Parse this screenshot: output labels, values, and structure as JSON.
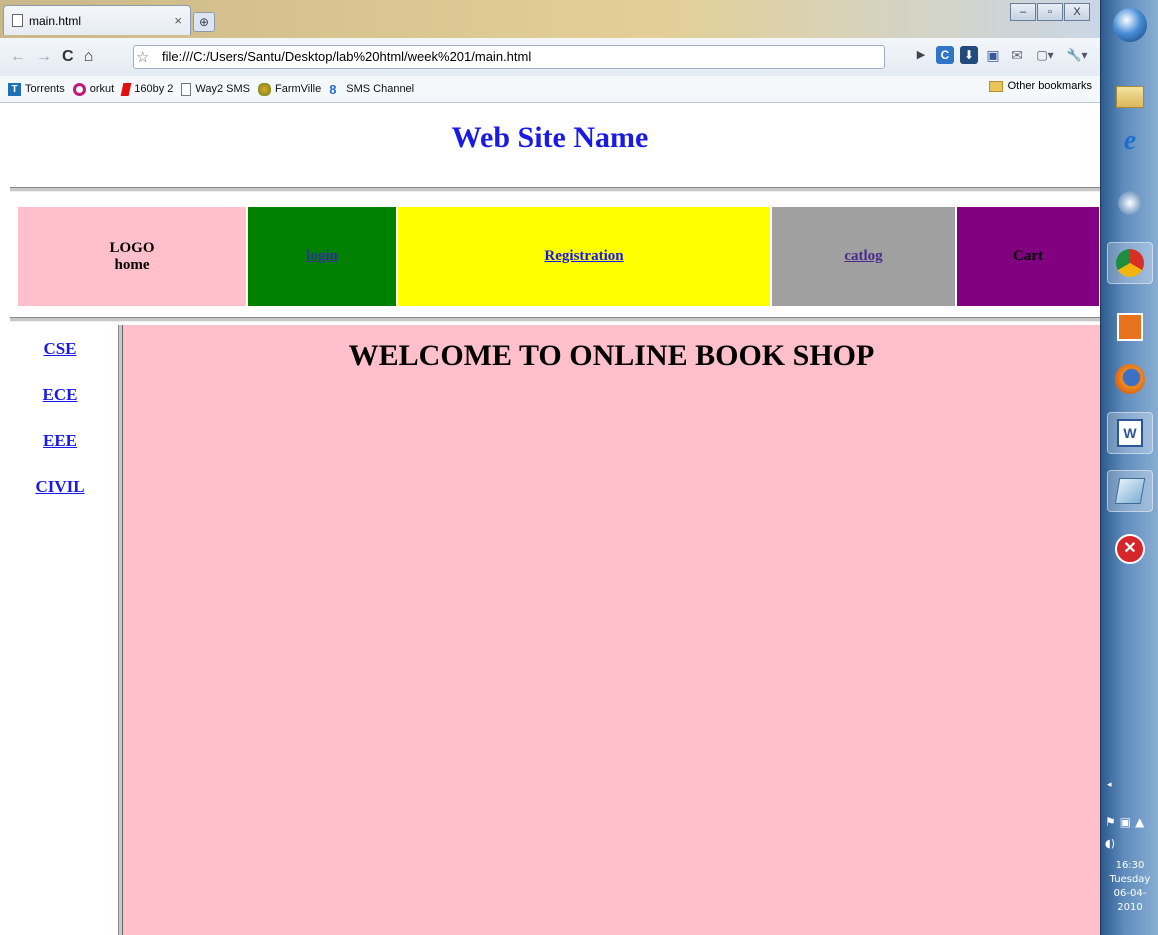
{
  "browser": {
    "tab_title": "main.html",
    "tab_close": "×",
    "new_tab": "⊕",
    "url": "file:///C:/Users/Santu/Desktop/lab%20html/week%201/main.html",
    "window_controls": [
      "–",
      "▫",
      "X"
    ],
    "nav": {
      "back": "←",
      "forward": "→",
      "reload": "C",
      "home": "⌂",
      "star": "☆"
    },
    "toolbar_icons": [
      "▶",
      "C",
      "⬇",
      "▣",
      "✉",
      "▢▾",
      "🔧▾"
    ],
    "bookmarks": [
      {
        "label": "Torrents",
        "icon": "torrents-icon",
        "color": "#1e6fb5"
      },
      {
        "label": "orkut",
        "icon": "orkut-icon",
        "color": "#c2187a"
      },
      {
        "label": "160by 2",
        "icon": "160by2-icon",
        "color": "#e01010"
      },
      {
        "label": "Way2 SMS",
        "icon": "page-icon",
        "color": "#ffffff"
      },
      {
        "label": "FarmVille",
        "icon": "farmville-icon",
        "color": "#d98b1a"
      },
      {
        "label": "SMS Channel",
        "icon": "sms-channel-icon",
        "color": "#2a6fcf"
      }
    ],
    "other_bookmarks": "Other bookmarks"
  },
  "page": {
    "site_name": "Web Site Name",
    "menu": {
      "logo": "LOGO",
      "home": "home",
      "login": "login",
      "registration": "Registration",
      "catalog": "catlog",
      "cart": "Cart"
    },
    "left_nav": [
      "CSE",
      "ECE",
      "EEE",
      "CIVIL"
    ],
    "welcome": "WELCOME TO ONLINE BOOK SHOP"
  },
  "taskbar": {
    "time": "16:30",
    "day": "Tuesday",
    "date": "06-04-2010",
    "icons": [
      "windows-start-icon",
      "explorer-folder-icon",
      "internet-explorer-icon",
      "2010-app-icon",
      "chrome-icon",
      "outlook-icon",
      "firefox-icon",
      "word-icon",
      "notepad-icon",
      "close-app-icon"
    ]
  },
  "colors": {
    "link": "#1a1ae6",
    "logo_cell": "#ffc0cb",
    "login_cell": "#008000",
    "registration_cell": "#ffff00",
    "catalog_cell": "#a0a0a0",
    "cart_cell": "#800080",
    "main_pane": "#ffc0cb"
  }
}
